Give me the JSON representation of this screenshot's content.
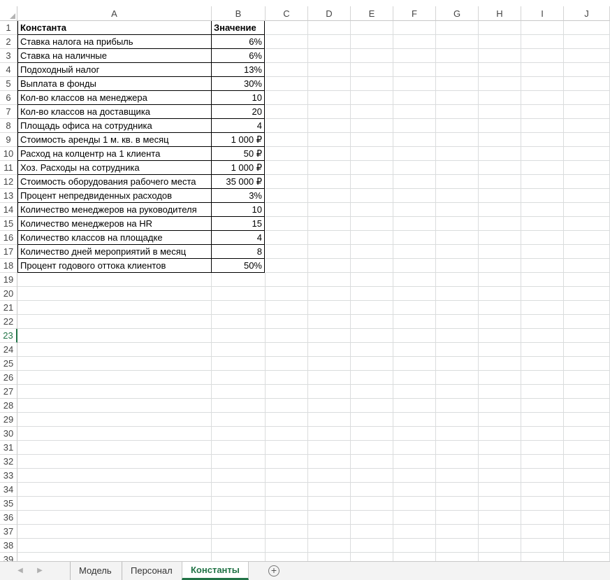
{
  "columns": [
    "A",
    "B",
    "C",
    "D",
    "E",
    "F",
    "G",
    "H",
    "I",
    "J"
  ],
  "rows": [
    {
      "n": "1",
      "a": "Константа",
      "b": "Значение"
    },
    {
      "n": "2",
      "a": "Ставка налога на прибыль",
      "b": "6%"
    },
    {
      "n": "3",
      "a": "Ставка на наличные",
      "b": "6%"
    },
    {
      "n": "4",
      "a": "Подоходный налог",
      "b": "13%"
    },
    {
      "n": "5",
      "a": "Выплата в фонды",
      "b": "30%"
    },
    {
      "n": "6",
      "a": "Кол-во классов на менеджера",
      "b": "10"
    },
    {
      "n": "7",
      "a": "Кол-во классов на доставщика",
      "b": "20"
    },
    {
      "n": "8",
      "a": "Площадь офиса на сотрудника",
      "b": "4"
    },
    {
      "n": "9",
      "a": "Стоимость аренды 1 м. кв. в месяц",
      "b": "1 000 ₽"
    },
    {
      "n": "10",
      "a": "Расход на колцентр на 1 клиента",
      "b": "50 ₽"
    },
    {
      "n": "11",
      "a": "Хоз. Расходы на сотрудника",
      "b": "1 000 ₽"
    },
    {
      "n": "12",
      "a": "Стоимость оборудования рабочего места",
      "b": "35 000 ₽"
    },
    {
      "n": "13",
      "a": "Процент непредвиденных расходов",
      "b": "3%"
    },
    {
      "n": "14",
      "a": "Количество менеджеров на руководителя",
      "b": "10"
    },
    {
      "n": "15",
      "a": "Количество менеджеров на HR",
      "b": "15"
    },
    {
      "n": "16",
      "a": "Количество классов на площадке",
      "b": "4"
    },
    {
      "n": "17",
      "a": "Количество дней мероприятий в месяц",
      "b": "8"
    },
    {
      "n": "18",
      "a": "Процент годового оттока клиентов",
      "b": "50%"
    }
  ],
  "empty_rows": [
    "19",
    "20",
    "21",
    "22",
    "23",
    "24",
    "25",
    "26",
    "27",
    "28",
    "29",
    "30",
    "31",
    "32",
    "33",
    "34",
    "35",
    "36",
    "37",
    "38",
    "39"
  ],
  "active_row": "23",
  "tabs": [
    {
      "label": "Модель",
      "active": false
    },
    {
      "label": "Персонал",
      "active": false
    },
    {
      "label": "Константы",
      "active": true
    }
  ],
  "add_sheet_icon": "plus-circle-icon",
  "accent_color": "#217346"
}
